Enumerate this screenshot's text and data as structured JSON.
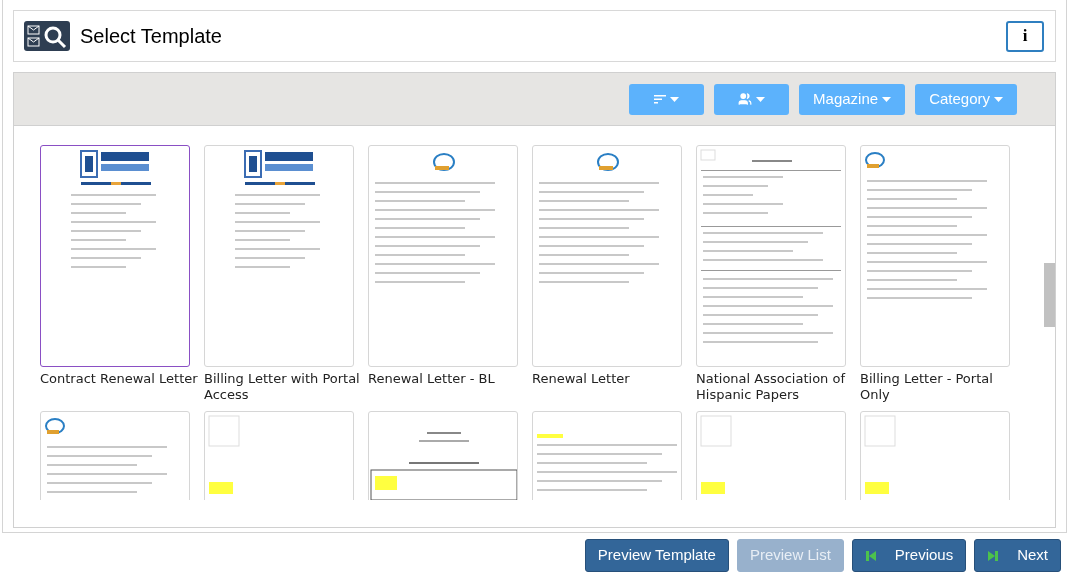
{
  "header": {
    "title": "Select Template",
    "info_label": "i"
  },
  "toolbar": {
    "buttons": [
      {
        "kind": "sort"
      },
      {
        "kind": "users"
      },
      {
        "kind": "text",
        "label": "Magazine"
      },
      {
        "kind": "text",
        "label": "Category"
      }
    ]
  },
  "templates": [
    {
      "name": "Contract Renewal Letter",
      "selected": true,
      "kind": "logo"
    },
    {
      "name": "Billing Letter with Portal Access",
      "selected": false,
      "kind": "logo"
    },
    {
      "name": "Renewal Letter - BL",
      "selected": false,
      "kind": "travel"
    },
    {
      "name": "Renewal Letter",
      "selected": false,
      "kind": "travel"
    },
    {
      "name": "National Association of Hispanic Papers",
      "selected": false,
      "kind": "form"
    },
    {
      "name": "Billing Letter - Portal Only",
      "selected": false,
      "kind": "travel-left"
    },
    {
      "selected": false,
      "kind": "travel-left"
    },
    {
      "selected": false,
      "kind": "highlight"
    },
    {
      "selected": false,
      "kind": "contract"
    },
    {
      "selected": false,
      "kind": "notice"
    },
    {
      "selected": false,
      "kind": "highlight"
    },
    {
      "selected": false,
      "kind": "highlight"
    }
  ],
  "footer": {
    "buttons": [
      {
        "label": "Preview Template",
        "disabled": false,
        "kind": "plain"
      },
      {
        "label": "Preview List",
        "disabled": true,
        "kind": "plain"
      },
      {
        "label": "Previous",
        "disabled": false,
        "kind": "prev"
      },
      {
        "label": "Next",
        "disabled": false,
        "kind": "next"
      }
    ]
  }
}
